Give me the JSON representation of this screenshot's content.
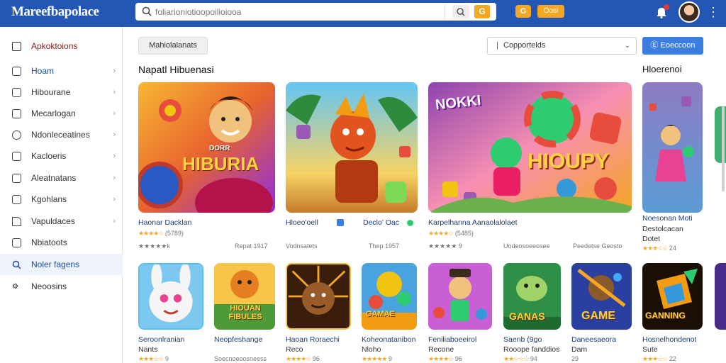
{
  "header": {
    "logo": "Mareefbapolace",
    "search_placeholder": "foliarioniotioopoilioiooa",
    "search_tag": "G",
    "coin_badge": "G",
    "coins_label": "Oosi",
    "more": "⋮"
  },
  "sidebar": {
    "heading": "Apkoktoions",
    "items": [
      {
        "label": "Hoam",
        "chevron": "›"
      },
      {
        "label": "Hibourane",
        "chevron": "›"
      },
      {
        "label": "Mecarlogan",
        "chevron": "›"
      },
      {
        "label": "Ndonleceatines",
        "chevron": "›"
      },
      {
        "label": "Kacloeris",
        "chevron": "›"
      },
      {
        "label": "Aleatnatans",
        "chevron": "›"
      },
      {
        "label": "Kgohlans",
        "chevron": "›"
      },
      {
        "label": "Vapuldaces",
        "chevron": "›"
      },
      {
        "label": "Nbiatoots",
        "chevron": ""
      },
      {
        "label": "Noler fagens",
        "chevron": ""
      },
      {
        "label": "Neoosins",
        "chevron": ""
      }
    ]
  },
  "toolbar": {
    "filter_label": "Mahiolalanats",
    "select_value": "Copportelds",
    "select_prefix": "|",
    "select_arrow": "⌄",
    "primary_label": "Ⓔ Eoeccoon"
  },
  "featured": {
    "title": "Napatl Hibuenasi",
    "right_title": "Hloerenoi",
    "cards": [
      {
        "art_text": "HIBURIA",
        "art_sub": "DORR",
        "name": "Haonar Dacklan",
        "rating": "★★★★☆",
        "reviews": "(5789)",
        "meta_left": "★★★★★k",
        "meta_right": "Repat 1917"
      },
      {
        "art_text": "",
        "name": "Hloeo'oell",
        "name2": "Declo' Oac",
        "meta_left": "Vodnsatets",
        "meta_right": "Thep 1957"
      },
      {
        "art_text": "HIOUPY",
        "art_sub": "NOKKI",
        "name": "Karpelhanna Aanaolalolaet",
        "rating": "★★★★☆",
        "reviews": "(5485)",
        "meta_left": "★★★★★ 9",
        "meta_right": "Uodeosoeeosee",
        "meta_far": "Peedetse Geosto"
      },
      {
        "art_text": "",
        "name": "Noesonan Moti",
        "name2": "Destolcacan",
        "name3": "Dotet",
        "rating": "★★★☆☆",
        "reviews": "24"
      }
    ]
  },
  "grid": {
    "cards": [
      {
        "art_text": "",
        "name": "Seroonlranian",
        "name2": "Nants",
        "rating": "★★★☆☆",
        "reviews": "9"
      },
      {
        "art_text": "HIOUAN FIBULES",
        "name": "Neopfeshange",
        "meta": "Soecnoeoosneess"
      },
      {
        "art_text": "",
        "name": "Haoan Roraechi",
        "name2": "Reco",
        "rating": "★★★★☆",
        "reviews": "96"
      },
      {
        "art_text": "GAMAE",
        "name": "Koheonatanibon",
        "name2": "Nloho",
        "rating": "★★★★★",
        "reviews": "9"
      },
      {
        "art_text": "",
        "name": "Feniliaboeeirol",
        "name2": "Recone",
        "rating": "★★★★☆",
        "reviews": "96"
      },
      {
        "art_text": "GANAS",
        "name": "Saenb (9go",
        "name2": "Rooope fanddios",
        "rating": "★★☆☆☆",
        "reviews": "94"
      },
      {
        "art_text": "GAME",
        "name": "Daneesaeora",
        "name2": "Dam",
        "reviews": "29"
      },
      {
        "art_text": "GANNING",
        "name": "Hosnelhondenot",
        "name2": "Sute",
        "rating": "★★★☆☆",
        "reviews": "22"
      }
    ]
  }
}
